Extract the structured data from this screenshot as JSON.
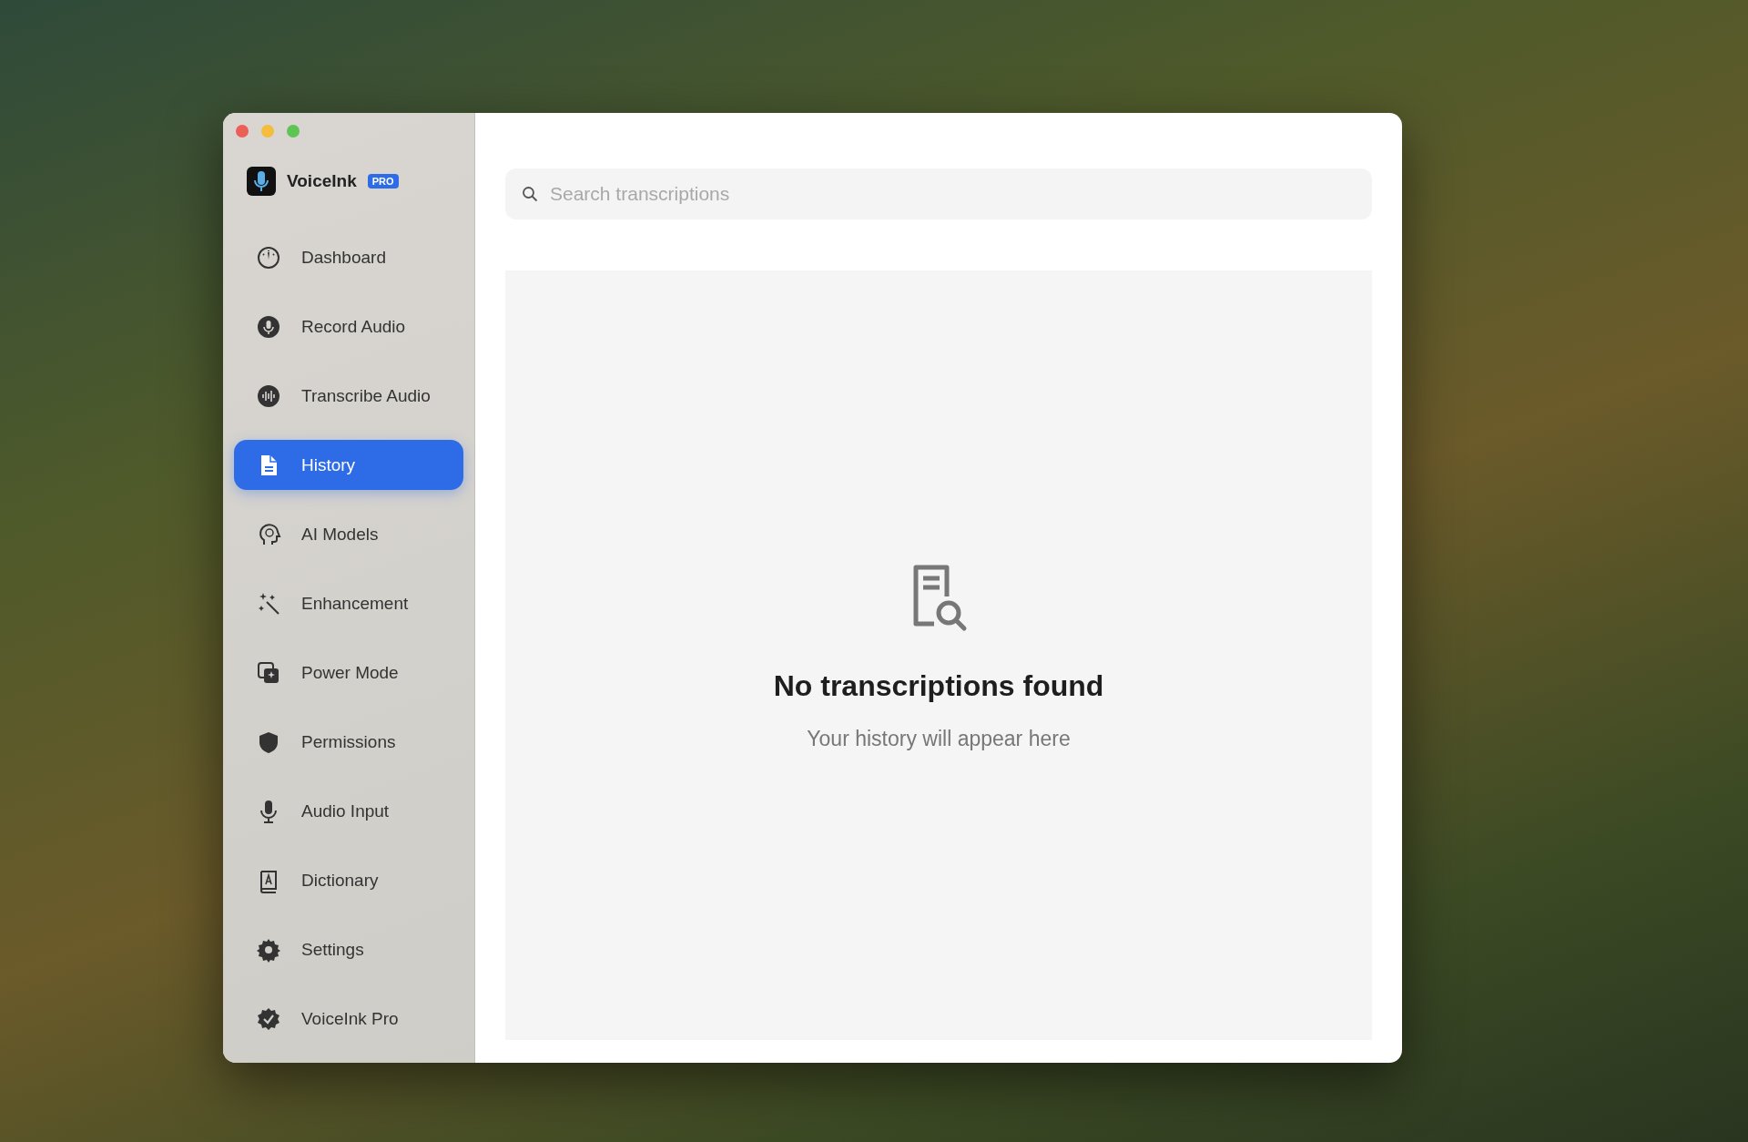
{
  "app": {
    "name": "VoiceInk",
    "badge": "PRO"
  },
  "sidebar": {
    "items": [
      {
        "label": "Dashboard",
        "selected": false
      },
      {
        "label": "Record Audio",
        "selected": false
      },
      {
        "label": "Transcribe Audio",
        "selected": false
      },
      {
        "label": "History",
        "selected": true
      },
      {
        "label": "AI Models",
        "selected": false
      },
      {
        "label": "Enhancement",
        "selected": false
      },
      {
        "label": "Power Mode",
        "selected": false
      },
      {
        "label": "Permissions",
        "selected": false
      },
      {
        "label": "Audio Input",
        "selected": false
      },
      {
        "label": "Dictionary",
        "selected": false
      },
      {
        "label": "Settings",
        "selected": false
      },
      {
        "label": "VoiceInk Pro",
        "selected": false
      }
    ]
  },
  "search": {
    "placeholder": "Search transcriptions"
  },
  "empty_state": {
    "title": "No transcriptions found",
    "message": "Your history will appear here"
  }
}
